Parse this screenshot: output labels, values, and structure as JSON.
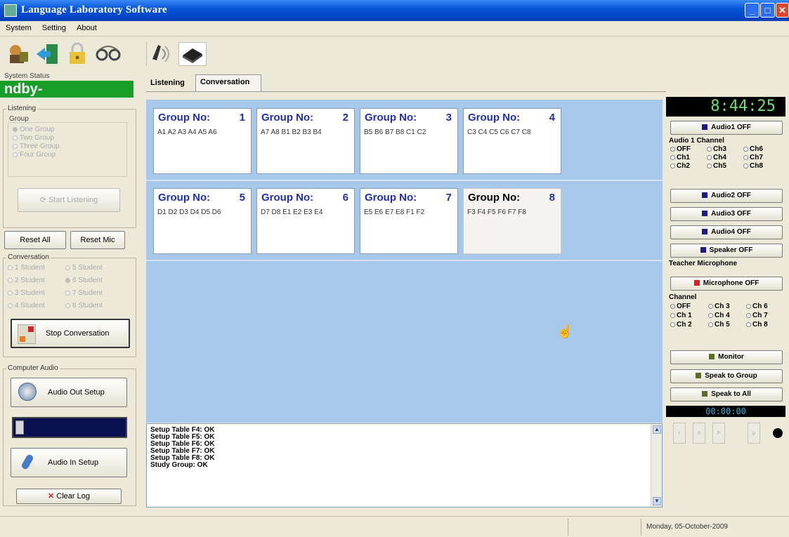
{
  "window": {
    "title": "Language Laboratory Software"
  },
  "menu": [
    "System",
    "Setting",
    "About"
  ],
  "toolbar": {
    "icons": [
      "teacher-icon",
      "exit-icon",
      "lock-icon",
      "headset-icon",
      "speaker-tool-icon",
      "device-icon"
    ]
  },
  "left": {
    "system_status_label": "System Status",
    "system_status_value": "ndby-",
    "listening_label": "Listening",
    "group_label": "Group",
    "group_options": [
      "One Group",
      "Two Group",
      "Three Group",
      "Four Group"
    ],
    "start_listening": "Start Listening",
    "reset_all": "Reset All",
    "reset_mic": "Reset Mic",
    "conversation_label": "Conversation",
    "conversation_options": [
      "1 Student",
      "5 Student",
      "2 Student",
      "6 Student",
      "3 Student",
      "7 Student",
      "4 Student",
      "8 Student"
    ],
    "stop_conversation": "Stop Conversation",
    "computer_audio_label": "Computer Audio",
    "audio_out_setup": "Audio Out Setup",
    "audio_in_setup": "Audio In Setup",
    "clear_log": "Clear Log"
  },
  "tabs": [
    "Listening",
    "Conversation"
  ],
  "groups": [
    {
      "label": "Group No:",
      "num": "1",
      "members": "A1 A2 A3 A4 A5 A6"
    },
    {
      "label": "Group No:",
      "num": "2",
      "members": "A7 A8 B1 B2 B3 B4"
    },
    {
      "label": "Group No:",
      "num": "3",
      "members": "B5 B6 B7 B8 C1 C2"
    },
    {
      "label": "Group No:",
      "num": "4",
      "members": "C3 C4 C5 C6 C7 C8"
    },
    {
      "label": "Group No:",
      "num": "5",
      "members": "D1 D2 D3 D4 D5 D6"
    },
    {
      "label": "Group No:",
      "num": "6",
      "members": "D7 D8 E1 E2 E3 E4"
    },
    {
      "label": "Group No:",
      "num": "7",
      "members": "E5 E6 E7 E8 F1 F2"
    },
    {
      "label": "Group No:",
      "num": "8",
      "members": "F3 F4 F5 F6 F7 F8"
    }
  ],
  "log": [
    "Setup Table F4: OK",
    "Setup Table F5: OK",
    "Setup Table F6: OK",
    "Setup Table F7: OK",
    "Setup Table F8: OK",
    "Study Group: OK"
  ],
  "right": {
    "clock": "8:44:25",
    "audio1": "Audio1 OFF",
    "audio1_channel_label": "Audio 1 Channel",
    "audio1_channels": [
      "OFF",
      "Ch3",
      "Ch6",
      "Ch1",
      "Ch4",
      "Ch7",
      "Ch2",
      "Ch5",
      "Ch8"
    ],
    "audio2": "Audio2 OFF",
    "audio3": "Audio3 OFF",
    "audio4": "Audio4 OFF",
    "speaker": "Speaker OFF",
    "teacher_mic_label": "Teacher Microphone",
    "microphone": "Microphone OFF",
    "channel_label": "Channel",
    "channels": [
      "OFF",
      "Ch 3",
      "Ch 6",
      "Ch 1",
      "Ch 4",
      "Ch 7",
      "Ch 2",
      "Ch 5",
      "Ch 8"
    ],
    "monitor": "Monitor",
    "speak_group": "Speak to Group",
    "speak_all": "Speak to All",
    "timer": "00:00:00",
    "player_buttons": [
      "r",
      "II",
      "P",
      "p"
    ]
  },
  "statusbar": {
    "date": "Monday, 05-October-2009"
  },
  "colors": {
    "status_green": "#1a9e2a",
    "main_area": "#a7c8e8",
    "group_title": "#1f2fb0"
  }
}
